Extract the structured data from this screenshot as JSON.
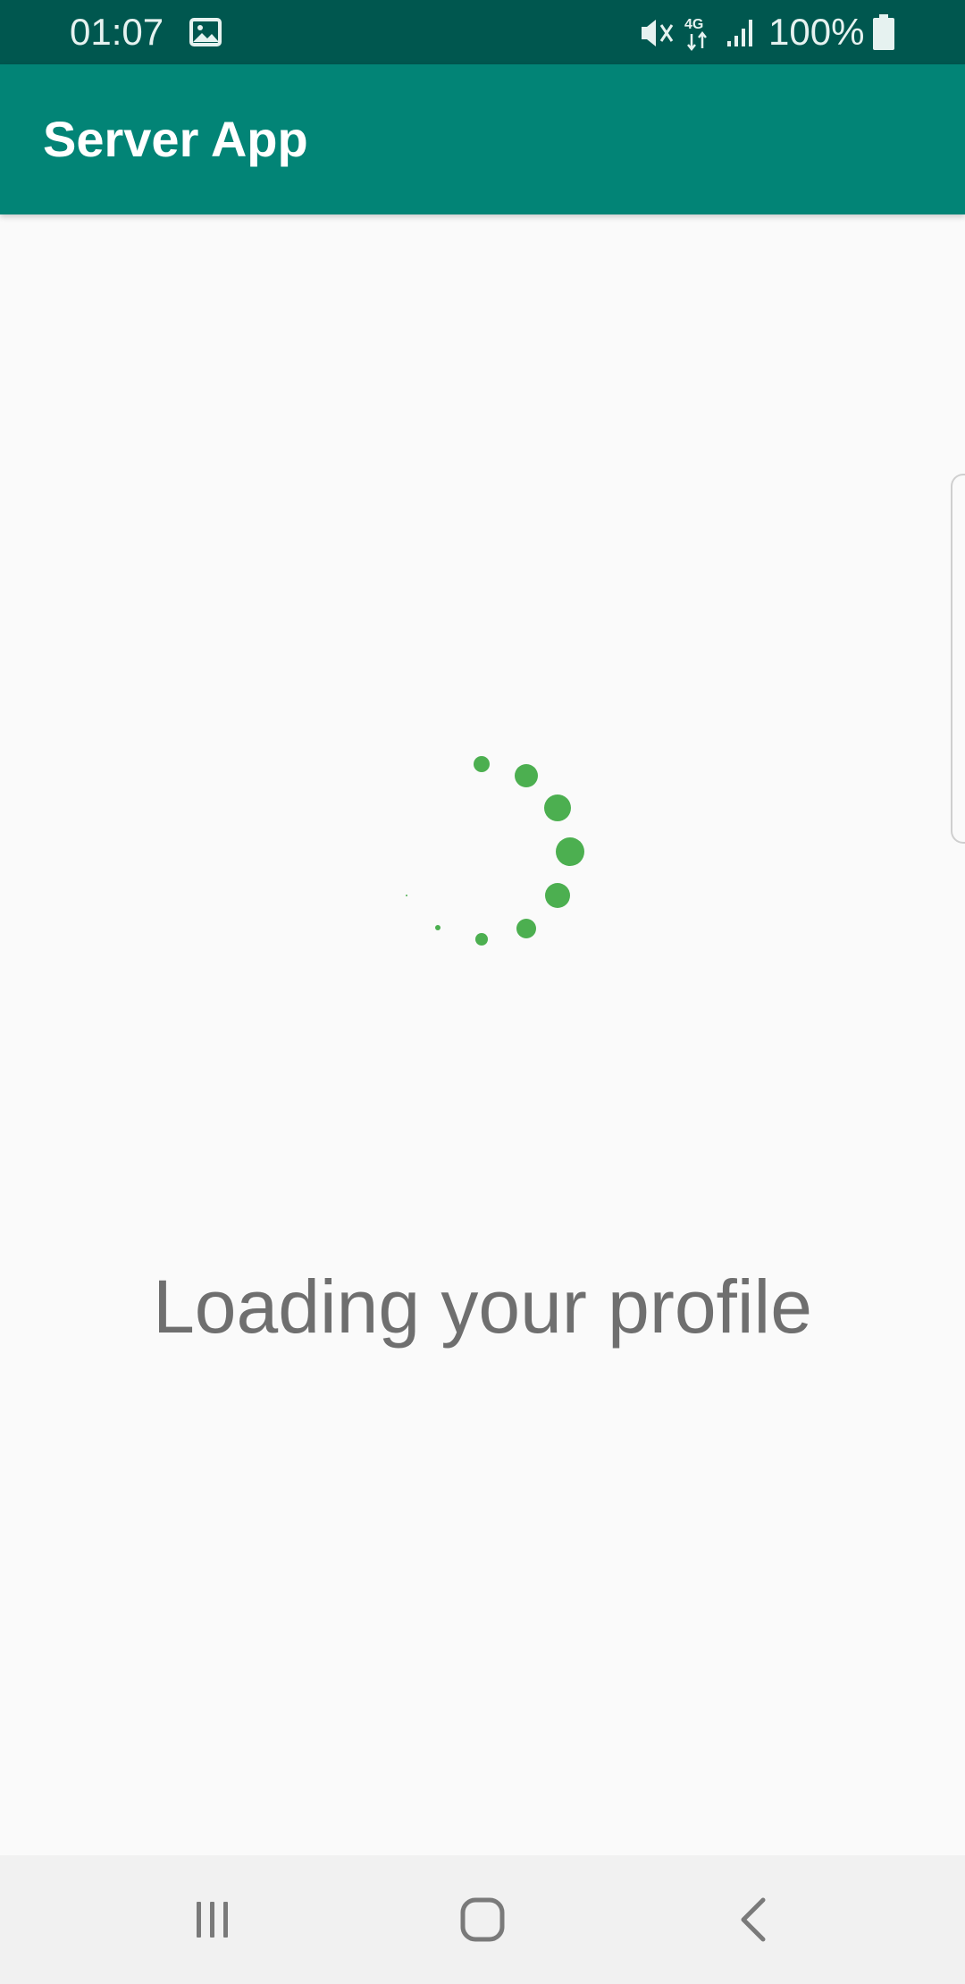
{
  "status_bar": {
    "time": "01:07",
    "battery": "100%",
    "icons": [
      "gallery-icon",
      "mute-vibrate-icon",
      "network-4g-icon",
      "signal-icon",
      "battery-icon"
    ]
  },
  "app_bar": {
    "title": "Server App",
    "color": "#028476"
  },
  "content": {
    "loading_message": "Loading your profile",
    "spinner_color": "#4caf50"
  },
  "nav_bar": {
    "buttons": [
      "recents-icon",
      "home-icon",
      "back-icon"
    ]
  }
}
